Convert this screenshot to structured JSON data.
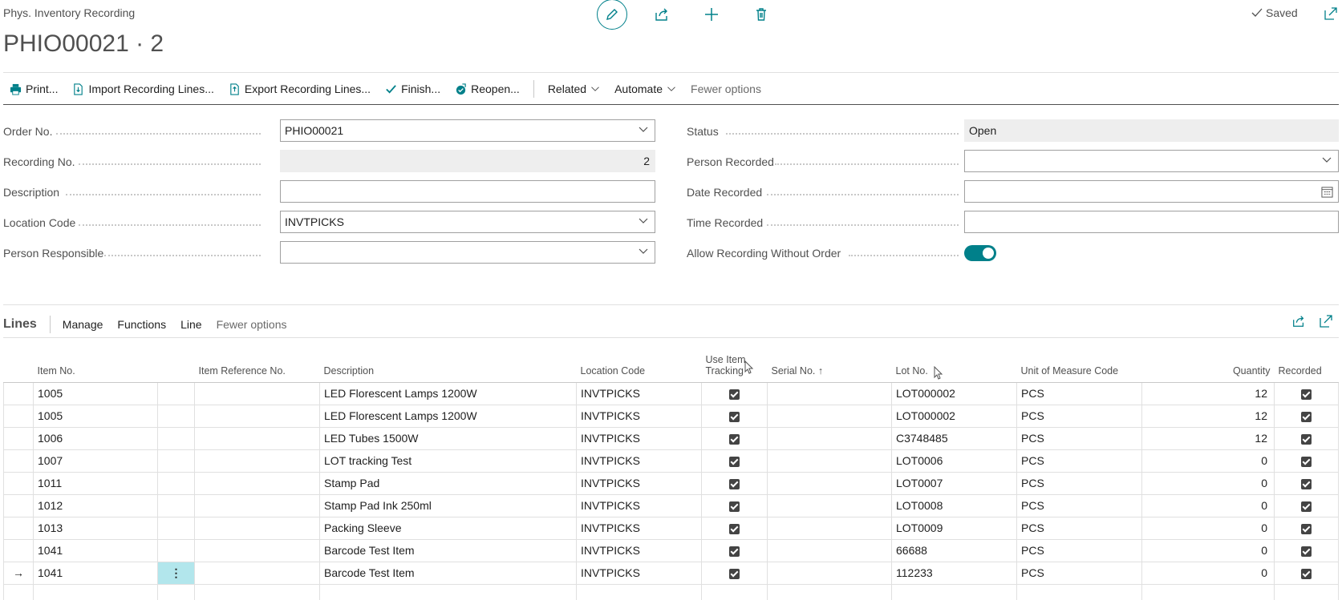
{
  "header": {
    "breadcrumb": "Phys. Inventory Recording",
    "title": "PHIO00021 · 2",
    "saved_label": "Saved"
  },
  "actions": {
    "print": "Print...",
    "import": "Import Recording Lines...",
    "export": "Export Recording Lines...",
    "finish": "Finish...",
    "reopen": "Reopen...",
    "related": "Related",
    "automate": "Automate",
    "fewer": "Fewer options"
  },
  "form": {
    "order_no": {
      "label": "Order No.",
      "value": "PHIO00021"
    },
    "recording_no": {
      "label": "Recording No.",
      "value": "2"
    },
    "description": {
      "label": "Description",
      "value": ""
    },
    "location_code": {
      "label": "Location Code",
      "value": "INVTPICKS"
    },
    "person_responsible": {
      "label": "Person Responsible",
      "value": ""
    },
    "status": {
      "label": "Status",
      "value": "Open"
    },
    "person_recorded": {
      "label": "Person Recorded",
      "value": ""
    },
    "date_recorded": {
      "label": "Date Recorded",
      "value": ""
    },
    "time_recorded": {
      "label": "Time Recorded",
      "value": ""
    },
    "allow_without_order": {
      "label": "Allow Recording Without Order",
      "value": true
    }
  },
  "lines": {
    "title": "Lines",
    "menu": [
      "Manage",
      "Functions",
      "Line",
      "Fewer options"
    ],
    "columns": {
      "item_no": "Item No.",
      "item_ref": "Item Reference No.",
      "description": "Description",
      "location": "Location Code",
      "use_tracking_1": "Use Item",
      "use_tracking_2": "Tracking",
      "serial": "Serial No. ↑",
      "lot": "Lot No.",
      "uom": "Unit of Measure Code",
      "quantity": "Quantity",
      "recorded": "Recorded"
    },
    "rows": [
      {
        "item_no": "1005",
        "description": "LED Florescent Lamps 1200W",
        "location": "INVTPICKS",
        "tracking": true,
        "serial": "",
        "lot": "LOT000002",
        "uom": "PCS",
        "quantity": "12",
        "recorded": true
      },
      {
        "item_no": "1005",
        "description": "LED Florescent Lamps 1200W",
        "location": "INVTPICKS",
        "tracking": true,
        "serial": "",
        "lot": "LOT000002",
        "uom": "PCS",
        "quantity": "12",
        "recorded": true
      },
      {
        "item_no": "1006",
        "description": "LED Tubes 1500W",
        "location": "INVTPICKS",
        "tracking": true,
        "serial": "",
        "lot": "C3748485",
        "uom": "PCS",
        "quantity": "12",
        "recorded": true
      },
      {
        "item_no": "1007",
        "description": "LOT tracking Test",
        "location": "INVTPICKS",
        "tracking": true,
        "serial": "",
        "lot": "LOT0006",
        "uom": "PCS",
        "quantity": "0",
        "recorded": true
      },
      {
        "item_no": "1011",
        "description": "Stamp Pad",
        "location": "INVTPICKS",
        "tracking": true,
        "serial": "",
        "lot": "LOT0007",
        "uom": "PCS",
        "quantity": "0",
        "recorded": true
      },
      {
        "item_no": "1012",
        "description": "Stamp Pad Ink 250ml",
        "location": "INVTPICKS",
        "tracking": true,
        "serial": "",
        "lot": "LOT0008",
        "uom": "PCS",
        "quantity": "0",
        "recorded": true
      },
      {
        "item_no": "1013",
        "description": "Packing Sleeve",
        "location": "INVTPICKS",
        "tracking": true,
        "serial": "",
        "lot": "LOT0009",
        "uom": "PCS",
        "quantity": "0",
        "recorded": true
      },
      {
        "item_no": "1041",
        "description": "Barcode Test Item",
        "location": "INVTPICKS",
        "tracking": true,
        "serial": "",
        "lot": "66688",
        "uom": "PCS",
        "quantity": "0",
        "recorded": true
      },
      {
        "item_no": "1041",
        "description": "Barcode Test Item",
        "location": "INVTPICKS",
        "tracking": true,
        "serial": "",
        "lot": "112233",
        "uom": "PCS",
        "quantity": "0",
        "recorded": true,
        "current": true
      }
    ]
  },
  "colors": {
    "accent": "#00808a",
    "selected_cell": "#b2e6ec"
  }
}
